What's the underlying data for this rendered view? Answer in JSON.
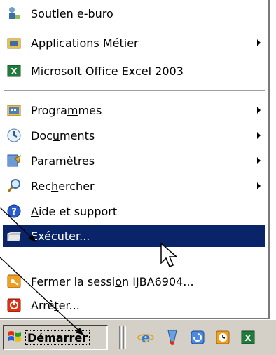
{
  "menu": {
    "items": [
      {
        "label_pre": "Soutien e-buro",
        "u": "",
        "label_post": "",
        "icon": "support-person-icon",
        "submenu": false
      },
      {
        "label_pre": "Applications Métier",
        "u": "",
        "label_post": "",
        "icon": "program-folder-icon",
        "submenu": true
      },
      {
        "label_pre": "Microsoft Office Excel 2003",
        "u": "",
        "label_post": "",
        "icon": "excel-icon",
        "submenu": false
      },
      {
        "label_pre": "Progra",
        "u": "m",
        "label_post": "mes",
        "icon": "programs-icon",
        "submenu": true
      },
      {
        "label_pre": "Doc",
        "u": "u",
        "label_post": "ments",
        "icon": "documents-icon",
        "submenu": true
      },
      {
        "label_pre": "",
        "u": "P",
        "label_post": "aramètres",
        "icon": "settings-icon",
        "submenu": true
      },
      {
        "label_pre": "Rec",
        "u": "h",
        "label_post": "ercher",
        "icon": "search-icon",
        "submenu": true
      },
      {
        "label_pre": "",
        "u": "A",
        "label_post": "ide et support",
        "icon": "help-icon",
        "submenu": false
      },
      {
        "label_pre": "E",
        "u": "x",
        "label_post": "écuter...",
        "icon": "run-icon",
        "submenu": false
      },
      {
        "label_pre": "Fermer la sessi",
        "u": "o",
        "label_post": "n IJBA6904...",
        "icon": "logoff-icon",
        "submenu": false
      },
      {
        "label_pre": "Arrê",
        "u": "t",
        "label_post": "er...",
        "icon": "shutdown-icon",
        "submenu": false
      }
    ]
  },
  "taskbar": {
    "start_label": "Démarrer",
    "quicklaunch": [
      "internet-explorer-icon",
      "thermometer-icon",
      "refresh-icon",
      "clock-icon",
      "excel-icon"
    ]
  },
  "colors": {
    "selection": "#0a246a",
    "taskbar": "#d4d0c8"
  }
}
